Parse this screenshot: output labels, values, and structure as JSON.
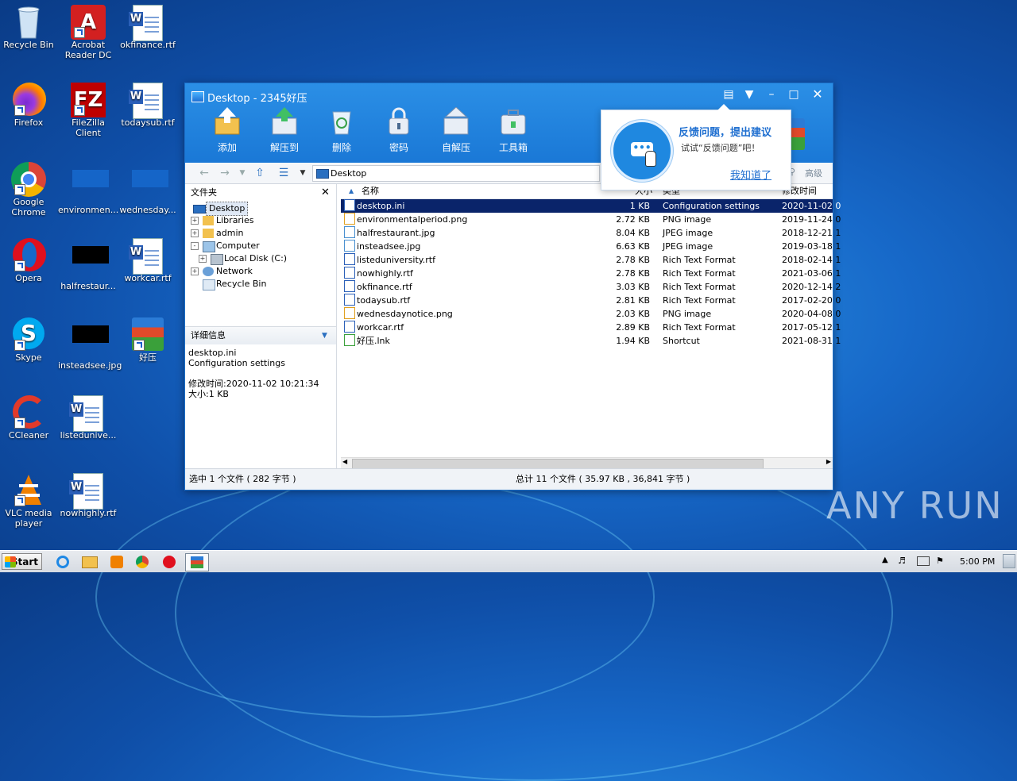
{
  "desktop_icons": [
    {
      "label": "Recycle Bin"
    },
    {
      "label": "Acrobat Reader DC"
    },
    {
      "label": "okfinance.rtf"
    },
    {
      "label": "Firefox"
    },
    {
      "label": "FileZilla Client"
    },
    {
      "label": "todaysub.rtf"
    },
    {
      "label": "Google Chrome"
    },
    {
      "label": "environmen..."
    },
    {
      "label": "wednesday..."
    },
    {
      "label": "Opera"
    },
    {
      "label": "halfrestaur..."
    },
    {
      "label": "workcar.rtf"
    },
    {
      "label": "Skype"
    },
    {
      "label": "insteadsee.jpg"
    },
    {
      "label": "好压"
    },
    {
      "label": "CCleaner"
    },
    {
      "label": "listedunive..."
    },
    {
      "label": "VLC media player"
    },
    {
      "label": "nowhighly.rtf"
    }
  ],
  "window": {
    "title": "Desktop - 2345好压",
    "toolbar": [
      "添加",
      "解压到",
      "删除",
      "密码",
      "自解压",
      "工具箱"
    ],
    "address": "Desktop",
    "search_button": "高级",
    "folders_header": "文件夹",
    "tree": [
      "Desktop",
      "Libraries",
      "admin",
      "Computer",
      "Local Disk (C:)",
      "Network",
      "Recycle Bin"
    ],
    "details_header": "详细信息",
    "details": {
      "name": "desktop.ini",
      "type": "Configuration settings",
      "modified": "修改时间:2020-11-02 10:21:34",
      "size": "大小:1 KB"
    },
    "columns": {
      "name": "名称",
      "size": "大小",
      "type": "类型",
      "modified": "修改时间"
    },
    "files": [
      {
        "name": "desktop.ini",
        "size": "1 KB",
        "type": "Configuration settings",
        "modified": "2020-11-02 0"
      },
      {
        "name": "environmentalperiod.png",
        "size": "2.72 KB",
        "type": "PNG image",
        "modified": "2019-11-24 0"
      },
      {
        "name": "halfrestaurant.jpg",
        "size": "8.04 KB",
        "type": "JPEG image",
        "modified": "2018-12-21 1"
      },
      {
        "name": "insteadsee.jpg",
        "size": "6.63 KB",
        "type": "JPEG image",
        "modified": "2019-03-18 1"
      },
      {
        "name": "listeduniversity.rtf",
        "size": "2.78 KB",
        "type": "Rich Text Format",
        "modified": "2018-02-14 1"
      },
      {
        "name": "nowhighly.rtf",
        "size": "2.78 KB",
        "type": "Rich Text Format",
        "modified": "2021-03-06 1"
      },
      {
        "name": "okfinance.rtf",
        "size": "3.03 KB",
        "type": "Rich Text Format",
        "modified": "2020-12-14 2"
      },
      {
        "name": "todaysub.rtf",
        "size": "2.81 KB",
        "type": "Rich Text Format",
        "modified": "2017-02-20 0"
      },
      {
        "name": "wednesdaynotice.png",
        "size": "2.03 KB",
        "type": "PNG image",
        "modified": "2020-04-08 0"
      },
      {
        "name": "workcar.rtf",
        "size": "2.89 KB",
        "type": "Rich Text Format",
        "modified": "2017-05-12 1"
      },
      {
        "name": "好压.lnk",
        "size": "1.94 KB",
        "type": "Shortcut",
        "modified": "2021-08-31 1"
      }
    ],
    "status_left": "选中 1 个文件 ( 282 字节 )",
    "status_right": "总计 11 个文件 ( 35.97 KB , 36,841 字节 )"
  },
  "popup": {
    "title": "反馈问题，提出建议",
    "subtitle": "试试“反馈问题”吧！",
    "link": "我知道了"
  },
  "taskbar": {
    "start_label": "Start",
    "clock": "5:00 PM"
  },
  "watermark": "ANY RUN"
}
